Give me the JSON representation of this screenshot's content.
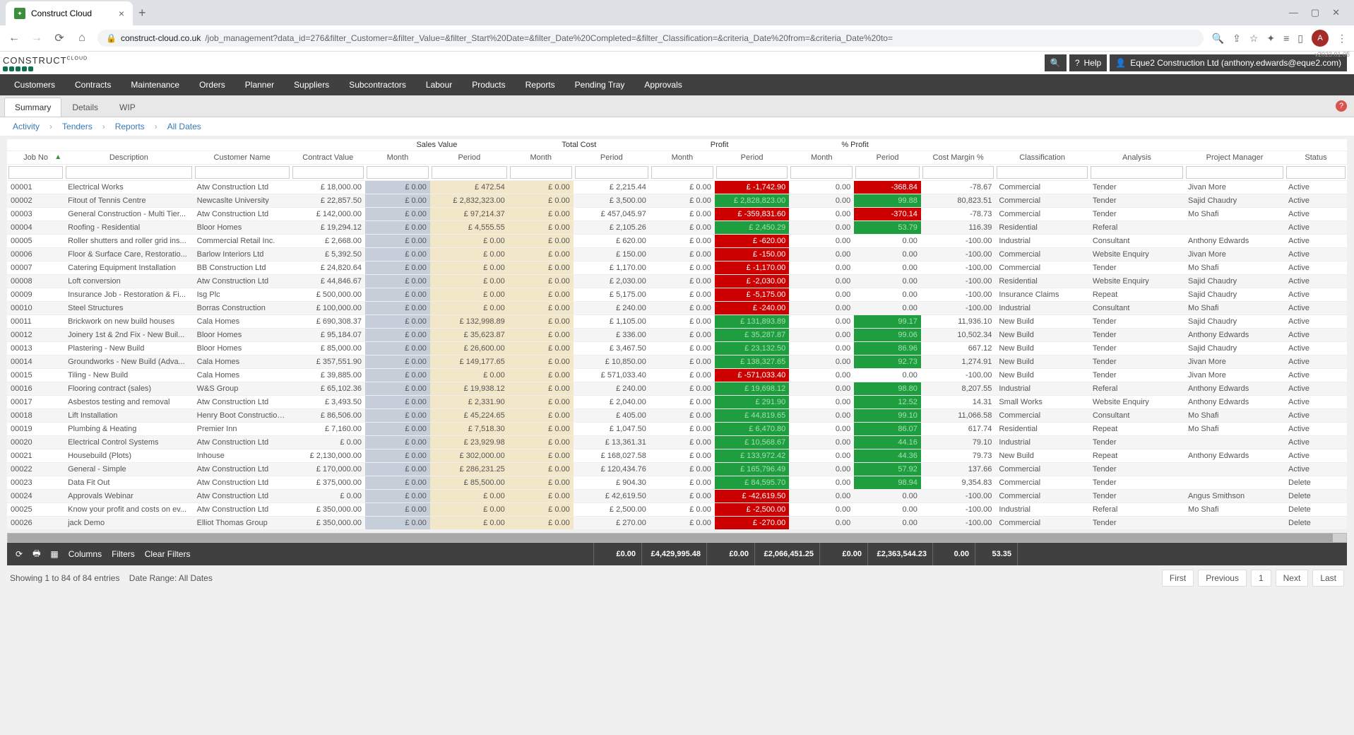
{
  "browser": {
    "tab_title": "Construct Cloud",
    "url_domain": "construct-cloud.co.uk",
    "url_path": "/job_management?data_id=276&filter_Customer=&filter_Value=&filter_Start%20Date=&filter_Date%20Completed=&filter_Classification=&criteria_Date%20from=&criteria_Date%20to=",
    "user_initial": "A"
  },
  "header": {
    "logo_top": "CLOUD",
    "logo_main": "CONSTRUCT",
    "help": "Help",
    "account": "Eque2 Construction Ltd (anthony.edwards@eque2.com)",
    "version": "v2023.01.05"
  },
  "nav": [
    "Customers",
    "Contracts",
    "Maintenance",
    "Orders",
    "Planner",
    "Suppliers",
    "Subcontractors",
    "Labour",
    "Products",
    "Reports",
    "Pending Tray",
    "Approvals"
  ],
  "subtabs": [
    "Summary",
    "Details",
    "WIP"
  ],
  "subtab_active": 0,
  "crumbs": [
    "Activity",
    "Tenders",
    "Reports",
    "All Dates"
  ],
  "columns": {
    "group_sv": "Sales Value",
    "group_tc": "Total Cost",
    "group_p": "Profit",
    "group_pp": "% Profit",
    "jobno": "Job No",
    "desc": "Description",
    "cust": "Customer Name",
    "cval": "Contract Value",
    "month": "Month",
    "period": "Period",
    "cm": "Cost Margin %",
    "class": "Classification",
    "anal": "Analysis",
    "pmgr": "Project Manager",
    "stat": "Status"
  },
  "rows": [
    {
      "jobno": "00001",
      "desc": "Electrical Works",
      "cust": "Atw Construction Ltd",
      "cval": "£ 18,000.00",
      "svm": "£ 0.00",
      "svp": "£ 472.54",
      "tcm": "£ 0.00",
      "tcp": "£ 2,215.44",
      "pm": "£ 0.00",
      "pp": "£ -1,742.90",
      "pp_cls": "neg",
      "ppm": "0.00",
      "ppp": "-368.84",
      "ppp_cls": "neg",
      "cm": "-78.67",
      "class": "Commercial",
      "anal": "Tender",
      "pmgr": "Jivan More",
      "stat": "Active"
    },
    {
      "jobno": "00002",
      "desc": "Fitout of Tennis Centre",
      "cust": "Newcaslte University",
      "cval": "£ 22,857.50",
      "svm": "£ 0.00",
      "svp": "£ 2,832,323.00",
      "tcm": "£ 0.00",
      "tcp": "£ 3,500.00",
      "pm": "£ 0.00",
      "pp": "£ 2,828,823.00",
      "pp_cls": "pos",
      "ppm": "0.00",
      "ppp": "99.88",
      "ppp_cls": "pos",
      "cm": "80,823.51",
      "class": "Commercial",
      "anal": "Tender",
      "pmgr": "Sajid Chaudry",
      "stat": "Active"
    },
    {
      "jobno": "00003",
      "desc": "General Construction - Multi Tier...",
      "cust": "Atw Construction Ltd",
      "cval": "£ 142,000.00",
      "svm": "£ 0.00",
      "svp": "£ 97,214.37",
      "tcm": "£ 0.00",
      "tcp": "£ 457,045.97",
      "pm": "£ 0.00",
      "pp": "£ -359,831.60",
      "pp_cls": "neg",
      "ppm": "0.00",
      "ppp": "-370.14",
      "ppp_cls": "neg",
      "cm": "-78.73",
      "class": "Commercial",
      "anal": "Tender",
      "pmgr": "Mo Shafi",
      "stat": "Active"
    },
    {
      "jobno": "00004",
      "desc": "Roofing - Residential",
      "cust": "Bloor Homes",
      "cval": "£ 19,294.12",
      "svm": "£ 0.00",
      "svp": "£ 4,555.55",
      "tcm": "£ 0.00",
      "tcp": "£ 2,105.26",
      "pm": "£ 0.00",
      "pp": "£ 2,450.29",
      "pp_cls": "pos",
      "ppm": "0.00",
      "ppp": "53.79",
      "ppp_cls": "pos",
      "cm": "116.39",
      "class": "Residential",
      "anal": "Referal",
      "pmgr": "",
      "stat": "Active"
    },
    {
      "jobno": "00005",
      "desc": "Roller shutters and roller grid ins...",
      "cust": "Commercial Retail Inc.",
      "cval": "£ 2,668.00",
      "svm": "£ 0.00",
      "svp": "£ 0.00",
      "tcm": "£ 0.00",
      "tcp": "£ 620.00",
      "pm": "£ 0.00",
      "pp": "£ -620.00",
      "pp_cls": "neg",
      "ppm": "0.00",
      "ppp": "0.00",
      "ppp_cls": "",
      "cm": "-100.00",
      "class": "Industrial",
      "anal": "Consultant",
      "pmgr": "Anthony Edwards",
      "stat": "Active"
    },
    {
      "jobno": "00006",
      "desc": "Floor & Surface Care, Restoratio...",
      "cust": "Barlow Interiors Ltd",
      "cval": "£ 5,392.50",
      "svm": "£ 0.00",
      "svp": "£ 0.00",
      "tcm": "£ 0.00",
      "tcp": "£ 150.00",
      "pm": "£ 0.00",
      "pp": "£ -150.00",
      "pp_cls": "neg",
      "ppm": "0.00",
      "ppp": "0.00",
      "ppp_cls": "",
      "cm": "-100.00",
      "class": "Commercial",
      "anal": "Website Enquiry",
      "pmgr": "Jivan More",
      "stat": "Active"
    },
    {
      "jobno": "00007",
      "desc": "Catering Equipment Installation",
      "cust": "BB Construction Ltd",
      "cval": "£ 24,820.64",
      "svm": "£ 0.00",
      "svp": "£ 0.00",
      "tcm": "£ 0.00",
      "tcp": "£ 1,170.00",
      "pm": "£ 0.00",
      "pp": "£ -1,170.00",
      "pp_cls": "neg",
      "ppm": "0.00",
      "ppp": "0.00",
      "ppp_cls": "",
      "cm": "-100.00",
      "class": "Commercial",
      "anal": "Tender",
      "pmgr": "Mo Shafi",
      "stat": "Active"
    },
    {
      "jobno": "00008",
      "desc": "Loft conversion",
      "cust": "Atw Construction Ltd",
      "cval": "£ 44,846.67",
      "svm": "£ 0.00",
      "svp": "£ 0.00",
      "tcm": "£ 0.00",
      "tcp": "£ 2,030.00",
      "pm": "£ 0.00",
      "pp": "£ -2,030.00",
      "pp_cls": "neg",
      "ppm": "0.00",
      "ppp": "0.00",
      "ppp_cls": "",
      "cm": "-100.00",
      "class": "Residential",
      "anal": "Website Enquiry",
      "pmgr": "Sajid Chaudry",
      "stat": "Active"
    },
    {
      "jobno": "00009",
      "desc": "Insurance Job - Restoration & Fi...",
      "cust": "Isg Plc",
      "cval": "£ 500,000.00",
      "svm": "£ 0.00",
      "svp": "£ 0.00",
      "tcm": "£ 0.00",
      "tcp": "£ 5,175.00",
      "pm": "£ 0.00",
      "pp": "£ -5,175.00",
      "pp_cls": "neg",
      "ppm": "0.00",
      "ppp": "0.00",
      "ppp_cls": "",
      "cm": "-100.00",
      "class": "Insurance Claims",
      "anal": "Repeat",
      "pmgr": "Sajid Chaudry",
      "stat": "Active"
    },
    {
      "jobno": "00010",
      "desc": "Steel Structures",
      "cust": "Borras Construction",
      "cval": "£ 100,000.00",
      "svm": "£ 0.00",
      "svp": "£ 0.00",
      "tcm": "£ 0.00",
      "tcp": "£ 240.00",
      "pm": "£ 0.00",
      "pp": "£ -240.00",
      "pp_cls": "neg",
      "ppm": "0.00",
      "ppp": "0.00",
      "ppp_cls": "",
      "cm": "-100.00",
      "class": "Industrial",
      "anal": "Consultant",
      "pmgr": "Mo Shafi",
      "stat": "Active"
    },
    {
      "jobno": "00011",
      "desc": "Brickwork on new build houses",
      "cust": "Cala Homes",
      "cval": "£ 690,308.37",
      "svm": "£ 0.00",
      "svp": "£ 132,998.89",
      "tcm": "£ 0.00",
      "tcp": "£ 1,105.00",
      "pm": "£ 0.00",
      "pp": "£ 131,893.89",
      "pp_cls": "pos",
      "ppm": "0.00",
      "ppp": "99.17",
      "ppp_cls": "pos",
      "cm": "11,936.10",
      "class": "New Build",
      "anal": "Tender",
      "pmgr": "Sajid Chaudry",
      "stat": "Active"
    },
    {
      "jobno": "00012",
      "desc": "Joinery 1st & 2nd Fix - New Buil...",
      "cust": "Bloor Homes",
      "cval": "£ 95,184.07",
      "svm": "£ 0.00",
      "svp": "£ 35,623.87",
      "tcm": "£ 0.00",
      "tcp": "£ 336.00",
      "pm": "£ 0.00",
      "pp": "£ 35,287.87",
      "pp_cls": "pos",
      "ppm": "0.00",
      "ppp": "99.06",
      "ppp_cls": "pos",
      "cm": "10,502.34",
      "class": "New Build",
      "anal": "Tender",
      "pmgr": "Anthony Edwards",
      "stat": "Active"
    },
    {
      "jobno": "00013",
      "desc": "Plastering - New Build",
      "cust": "Bloor Homes",
      "cval": "£ 85,000.00",
      "svm": "£ 0.00",
      "svp": "£ 26,600.00",
      "tcm": "£ 0.00",
      "tcp": "£ 3,467.50",
      "pm": "£ 0.00",
      "pp": "£ 23,132.50",
      "pp_cls": "pos",
      "ppm": "0.00",
      "ppp": "86.96",
      "ppp_cls": "pos",
      "cm": "667.12",
      "class": "New Build",
      "anal": "Tender",
      "pmgr": "Sajid Chaudry",
      "stat": "Active"
    },
    {
      "jobno": "00014",
      "desc": "Groundworks - New Build (Adva...",
      "cust": "Cala Homes",
      "cval": "£ 357,551.90",
      "svm": "£ 0.00",
      "svp": "£ 149,177.65",
      "tcm": "£ 0.00",
      "tcp": "£ 10,850.00",
      "pm": "£ 0.00",
      "pp": "£ 138,327.65",
      "pp_cls": "pos",
      "ppm": "0.00",
      "ppp": "92.73",
      "ppp_cls": "pos",
      "cm": "1,274.91",
      "class": "New Build",
      "anal": "Tender",
      "pmgr": "Jivan More",
      "stat": "Active"
    },
    {
      "jobno": "00015",
      "desc": "Tiling - New Build",
      "cust": "Cala Homes",
      "cval": "£ 39,885.00",
      "svm": "£ 0.00",
      "svp": "£ 0.00",
      "tcm": "£ 0.00",
      "tcp": "£ 571,033.40",
      "pm": "£ 0.00",
      "pp": "£ -571,033.40",
      "pp_cls": "neg",
      "ppm": "0.00",
      "ppp": "0.00",
      "ppp_cls": "",
      "cm": "-100.00",
      "class": "New Build",
      "anal": "Tender",
      "pmgr": "Jivan More",
      "stat": "Active"
    },
    {
      "jobno": "00016",
      "desc": "Flooring contract (sales)",
      "cust": "W&S Group",
      "cval": "£ 65,102.36",
      "svm": "£ 0.00",
      "svp": "£ 19,938.12",
      "tcm": "£ 0.00",
      "tcp": "£ 240.00",
      "pm": "£ 0.00",
      "pp": "£ 19,698.12",
      "pp_cls": "pos",
      "ppm": "0.00",
      "ppp": "98.80",
      "ppp_cls": "pos",
      "cm": "8,207.55",
      "class": "Industrial",
      "anal": "Referal",
      "pmgr": "Anthony Edwards",
      "stat": "Active"
    },
    {
      "jobno": "00017",
      "desc": "Asbestos testing and removal",
      "cust": "Atw Construction Ltd",
      "cval": "£ 3,493.50",
      "svm": "£ 0.00",
      "svp": "£ 2,331.90",
      "tcm": "£ 0.00",
      "tcp": "£ 2,040.00",
      "pm": "£ 0.00",
      "pp": "£ 291.90",
      "pp_cls": "pos",
      "ppm": "0.00",
      "ppp": "12.52",
      "ppp_cls": "pos",
      "cm": "14.31",
      "class": "Small Works",
      "anal": "Website Enquiry",
      "pmgr": "Anthony Edwards",
      "stat": "Active"
    },
    {
      "jobno": "00018",
      "desc": "Lift Installation",
      "cust": "Henry Boot Construction...",
      "cval": "£ 86,506.00",
      "svm": "£ 0.00",
      "svp": "£ 45,224.65",
      "tcm": "£ 0.00",
      "tcp": "£ 405.00",
      "pm": "£ 0.00",
      "pp": "£ 44,819.65",
      "pp_cls": "pos",
      "ppm": "0.00",
      "ppp": "99.10",
      "ppp_cls": "pos",
      "cm": "11,066.58",
      "class": "Commercial",
      "anal": "Consultant",
      "pmgr": "Mo Shafi",
      "stat": "Active"
    },
    {
      "jobno": "00019",
      "desc": "Plumbing & Heating",
      "cust": "Premier Inn",
      "cval": "£ 7,160.00",
      "svm": "£ 0.00",
      "svp": "£ 7,518.30",
      "tcm": "£ 0.00",
      "tcp": "£ 1,047.50",
      "pm": "£ 0.00",
      "pp": "£ 6,470.80",
      "pp_cls": "pos",
      "ppm": "0.00",
      "ppp": "86.07",
      "ppp_cls": "pos",
      "cm": "617.74",
      "class": "Residential",
      "anal": "Repeat",
      "pmgr": "Mo Shafi",
      "stat": "Active"
    },
    {
      "jobno": "00020",
      "desc": "Electrical Control Systems",
      "cust": "Atw Construction Ltd",
      "cval": "£ 0.00",
      "svm": "£ 0.00",
      "svp": "£ 23,929.98",
      "tcm": "£ 0.00",
      "tcp": "£ 13,361.31",
      "pm": "£ 0.00",
      "pp": "£ 10,568.67",
      "pp_cls": "pos",
      "ppm": "0.00",
      "ppp": "44.16",
      "ppp_cls": "pos",
      "cm": "79.10",
      "class": "Industrial",
      "anal": "Tender",
      "pmgr": "",
      "stat": "Active"
    },
    {
      "jobno": "00021",
      "desc": "Housebuild (Plots)",
      "cust": "Inhouse",
      "cval": "£ 2,130,000.00",
      "svm": "£ 0.00",
      "svp": "£ 302,000.00",
      "tcm": "£ 0.00",
      "tcp": "£ 168,027.58",
      "pm": "£ 0.00",
      "pp": "£ 133,972.42",
      "pp_cls": "pos",
      "ppm": "0.00",
      "ppp": "44.36",
      "ppp_cls": "pos",
      "cm": "79.73",
      "class": "New Build",
      "anal": "Repeat",
      "pmgr": "Anthony Edwards",
      "stat": "Active"
    },
    {
      "jobno": "00022",
      "desc": "General - Simple",
      "cust": "Atw Construction Ltd",
      "cval": "£ 170,000.00",
      "svm": "£ 0.00",
      "svp": "£ 286,231.25",
      "tcm": "£ 0.00",
      "tcp": "£ 120,434.76",
      "pm": "£ 0.00",
      "pp": "£ 165,796.49",
      "pp_cls": "pos",
      "ppm": "0.00",
      "ppp": "57.92",
      "ppp_cls": "pos",
      "cm": "137.66",
      "class": "Commercial",
      "anal": "Tender",
      "pmgr": "",
      "stat": "Active"
    },
    {
      "jobno": "00023",
      "desc": "Data Fit Out",
      "cust": "Atw Construction Ltd",
      "cval": "£ 375,000.00",
      "svm": "£ 0.00",
      "svp": "£ 85,500.00",
      "tcm": "£ 0.00",
      "tcp": "£ 904.30",
      "pm": "£ 0.00",
      "pp": "£ 84,595.70",
      "pp_cls": "pos",
      "ppm": "0.00",
      "ppp": "98.94",
      "ppp_cls": "pos",
      "cm": "9,354.83",
      "class": "Commercial",
      "anal": "Tender",
      "pmgr": "",
      "stat": "Delete"
    },
    {
      "jobno": "00024",
      "desc": "Approvals Webinar",
      "cust": "Atw Construction Ltd",
      "cval": "£ 0.00",
      "svm": "£ 0.00",
      "svp": "£ 0.00",
      "tcm": "£ 0.00",
      "tcp": "£ 42,619.50",
      "pm": "£ 0.00",
      "pp": "£ -42,619.50",
      "pp_cls": "neg",
      "ppm": "0.00",
      "ppp": "0.00",
      "ppp_cls": "",
      "cm": "-100.00",
      "class": "Commercial",
      "anal": "Tender",
      "pmgr": "Angus Smithson",
      "stat": "Delete"
    },
    {
      "jobno": "00025",
      "desc": "Know your profit and costs on ev...",
      "cust": "Atw Construction Ltd",
      "cval": "£ 350,000.00",
      "svm": "£ 0.00",
      "svp": "£ 0.00",
      "tcm": "£ 0.00",
      "tcp": "£ 2,500.00",
      "pm": "£ 0.00",
      "pp": "£ -2,500.00",
      "pp_cls": "neg",
      "ppm": "0.00",
      "ppp": "0.00",
      "ppp_cls": "",
      "cm": "-100.00",
      "class": "Industrial",
      "anal": "Referal",
      "pmgr": "Mo Shafi",
      "stat": "Delete"
    },
    {
      "jobno": "00026",
      "desc": "jack Demo",
      "cust": "Elliot Thomas Group",
      "cval": "£ 350,000.00",
      "svm": "£ 0.00",
      "svp": "£ 0.00",
      "tcm": "£ 0.00",
      "tcp": "£ 270.00",
      "pm": "£ 0.00",
      "pp": "£ -270.00",
      "pp_cls": "neg",
      "ppm": "0.00",
      "ppp": "0.00",
      "ppp_cls": "",
      "cm": "-100.00",
      "class": "Commercial",
      "anal": "Tender",
      "pmgr": "",
      "stat": "Delete"
    }
  ],
  "footer": {
    "columns": "Columns",
    "filters": "Filters",
    "clear": "Clear Filters",
    "totals": {
      "svm": "£0.00",
      "svp": "£4,429,995.48",
      "tcm": "£0.00",
      "tcp": "£2,066,451.25",
      "pm": "£0.00",
      "pp": "£2,363,544.23",
      "ppm": "0.00",
      "ppp": "53.35"
    }
  },
  "status": {
    "showing": "Showing 1 to 84 of 84 entries",
    "range": "Date Range: All Dates",
    "first": "First",
    "prev": "Previous",
    "page": "1",
    "next": "Next",
    "last": "Last"
  }
}
